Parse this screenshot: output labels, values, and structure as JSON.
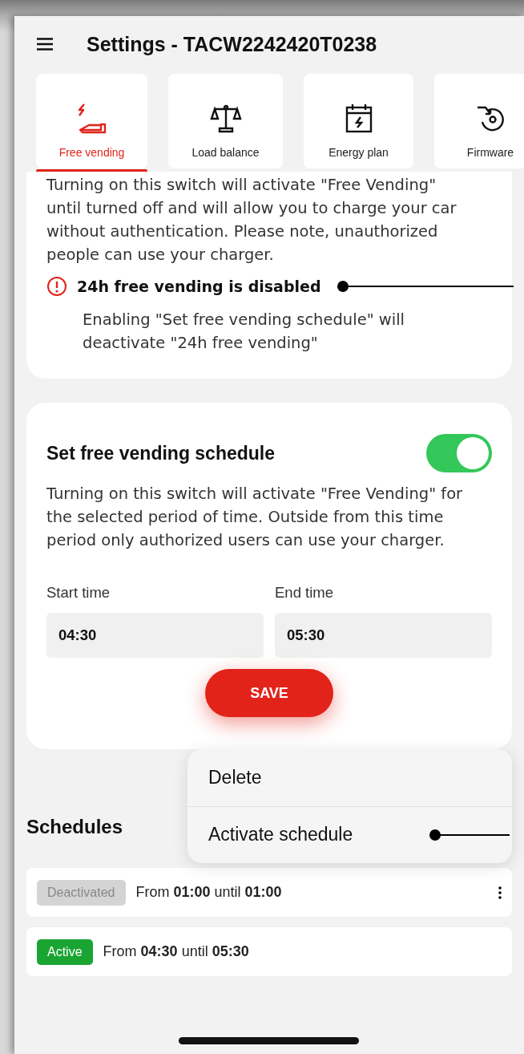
{
  "header": {
    "title": "Settings - TACW2242420T0238"
  },
  "tabs": [
    {
      "label": "Free vending",
      "selected": true
    },
    {
      "label": "Load balance",
      "selected": false
    },
    {
      "label": "Energy plan",
      "selected": false
    },
    {
      "label": "Firmware",
      "selected": false
    }
  ],
  "free_vending_card": {
    "description": "Turning on this switch will activate \"Free Vending\" until turned off and will allow you to charge your car without authentication. Please note, unauthorized people can use your charger.",
    "warning": {
      "title": "24h free vending is disabled",
      "message": "Enabling \"Set free vending schedule\" will deactivate \"24h free vending\""
    }
  },
  "schedule_card": {
    "title": "Set free vending schedule",
    "on": true,
    "description": "Turning on this switch will activate \"Free Vending\" for the selected period of time. Outside from this time period only authorized users can use your charger.",
    "fields": [
      {
        "label": "Start time",
        "value": "04:30"
      },
      {
        "label": "End time",
        "value": "05:30"
      }
    ],
    "save": "SAVE"
  },
  "menu": {
    "items": [
      "Delete",
      "Activate schedule"
    ]
  },
  "schedules": {
    "heading": "Schedules",
    "rows": [
      {
        "status": "Deactivated",
        "active": false,
        "text": "From **01:00** until **01:00**",
        "has_menu": true
      },
      {
        "status": "Active",
        "active": true,
        "text": "From **04:30** until **05:30**",
        "has_menu": false
      }
    ]
  }
}
